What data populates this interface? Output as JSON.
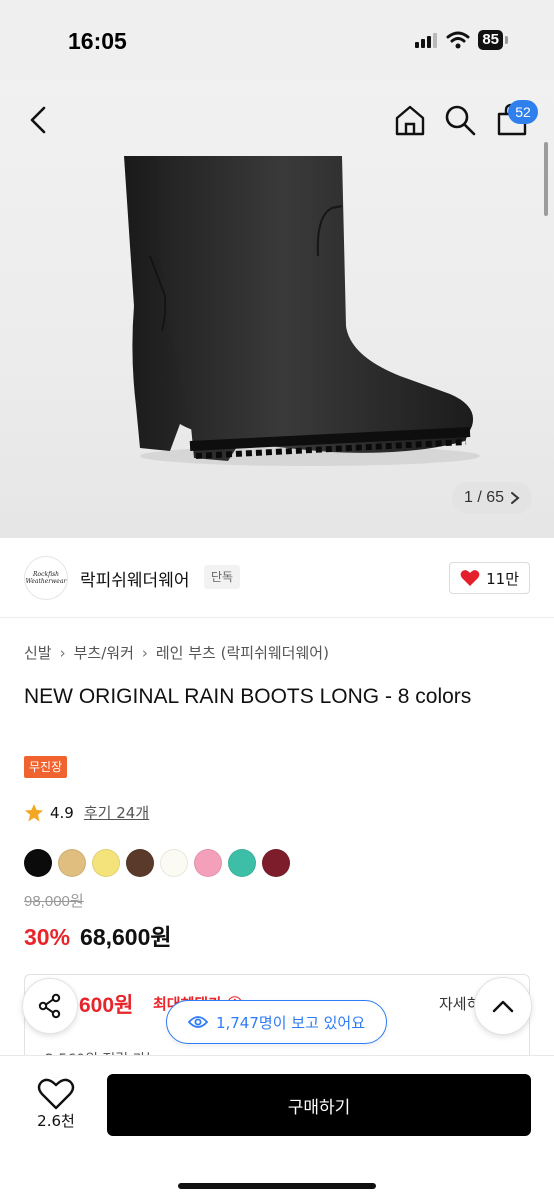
{
  "status_bar": {
    "time": "16:05",
    "battery": "85"
  },
  "header": {
    "cart_count": "52",
    "icons": [
      "back-icon",
      "home-icon",
      "search-icon",
      "cart-icon"
    ]
  },
  "gallery": {
    "counter": "1 / 65"
  },
  "brand": {
    "name": "락피쉬웨더웨어",
    "tag": "단독",
    "logo_text": "Rockfish Weatherwear",
    "likes": "11만"
  },
  "breadcrumb": [
    "신발",
    "부츠/워커",
    "레인 부츠 (락피쉬웨더웨어)"
  ],
  "product": {
    "title": "NEW ORIGINAL RAIN BOOTS LONG - 8 colors",
    "shipping_badge": "무진장",
    "rating": "4.9",
    "reviews": "후기 24개",
    "colors": [
      "#0b0b0b",
      "#dfbe7f",
      "#f4e27a",
      "#5a3a2a",
      "#fbfbf3",
      "#f5a0bb",
      "#3dbfa7",
      "#7d1d2b"
    ],
    "original_price": "98,000원",
    "discount": "30%",
    "sale_price": "68,600원"
  },
  "benefit": {
    "amount": "600원",
    "label": "최대혜택가 ⓘ",
    "detail_link": "자세히",
    "sub_text": "2,560원 적립 가능"
  },
  "viewers": {
    "text": "1,747명이 보고 있어요"
  },
  "bottom": {
    "wishlist_count": "2.6천",
    "buy_label": "구매하기"
  }
}
